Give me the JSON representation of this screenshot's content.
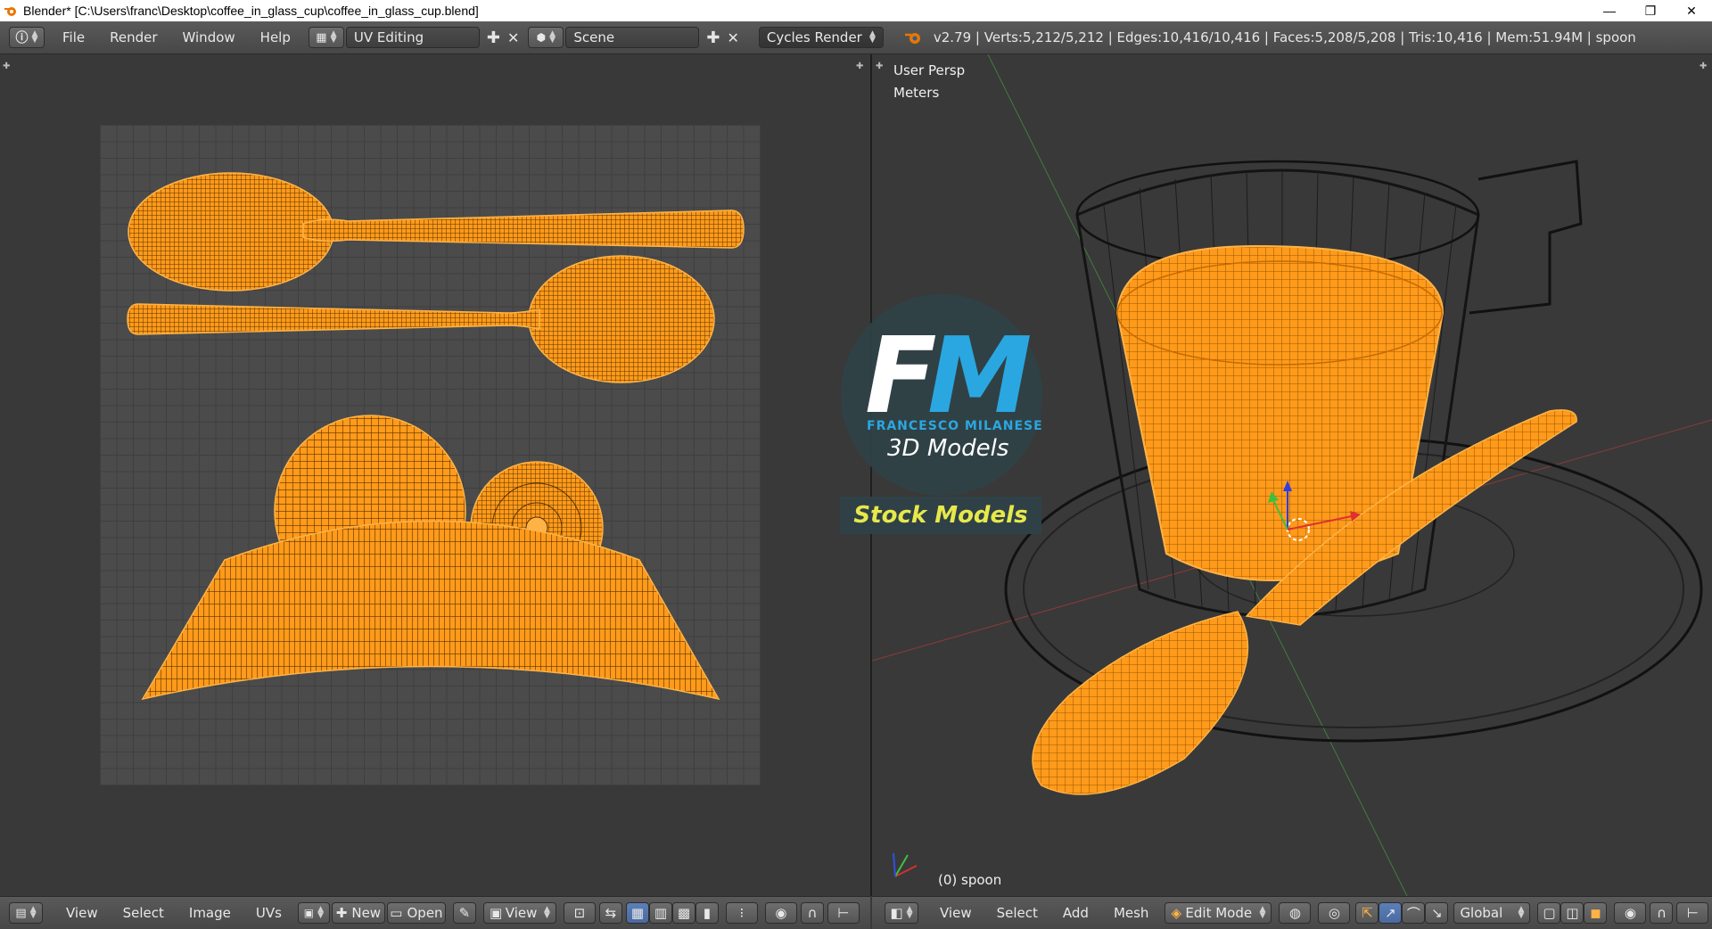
{
  "window": {
    "title": "Blender* [C:\\Users\\franc\\Desktop\\coffee_in_glass_cup\\coffee_in_glass_cup.blend]",
    "controls": {
      "minimize": "—",
      "restore": "❐",
      "close": "✕"
    }
  },
  "header": {
    "menus": [
      "File",
      "Render",
      "Window",
      "Help"
    ],
    "screen_layout": "UV Editing",
    "scene": "Scene",
    "render_engine": "Cycles Render",
    "stats": "v2.79 | Verts:5,212/5,212 | Edges:10,416/10,416 | Faces:5,208/5,208 | Tris:10,416 | Mem:51.94M | spoon"
  },
  "uv_editor": {
    "footer": {
      "menus": [
        "View",
        "Select",
        "Image",
        "UVs"
      ],
      "new_label": "New",
      "open_label": "Open",
      "view_label": "View"
    }
  },
  "viewport": {
    "persp_label": "User Persp",
    "units_label": "Meters",
    "object_label": "(0) spoon",
    "footer": {
      "menus": [
        "View",
        "Select",
        "Add",
        "Mesh"
      ],
      "mode": "Edit Mode",
      "orientation": "Global"
    }
  },
  "watermark": {
    "letters_f": "F",
    "letters_m": "M",
    "brand": "FRANCESCO MILANESE",
    "tagline": "3D Models",
    "badge": "Stock Models"
  },
  "colors": {
    "mesh_orange": "#ff9a1a",
    "accent_blue": "#2aa7e0",
    "badge_yellow": "#e7e84a"
  }
}
